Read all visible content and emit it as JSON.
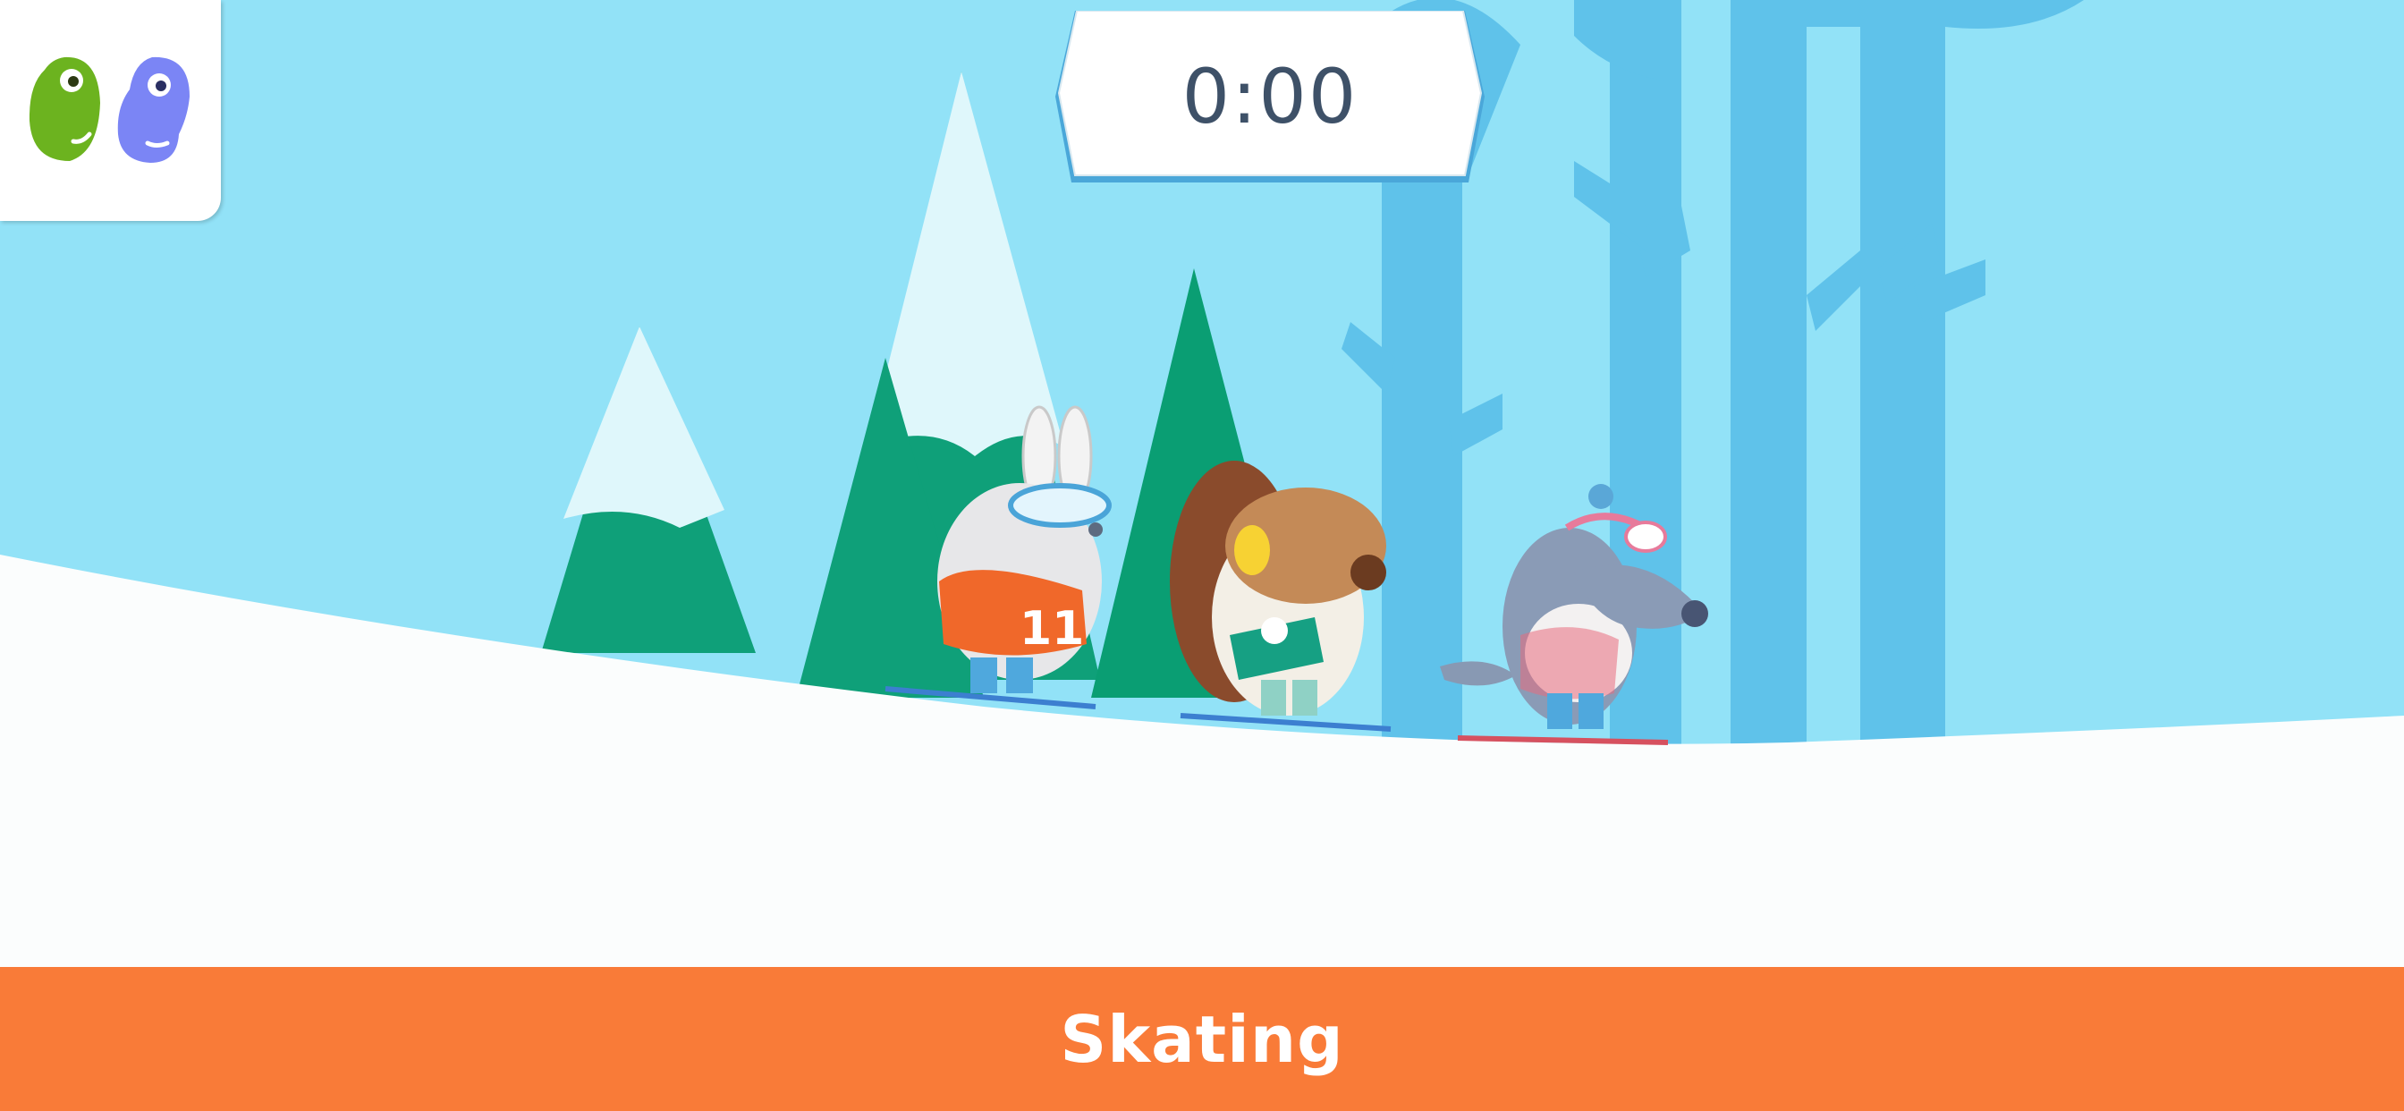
{
  "game": {
    "timer": "0:00",
    "activity_title": "Skating"
  },
  "logo": {
    "icon": "two-bean-characters-logo",
    "colors": [
      "#6cb31f",
      "#7b85f5"
    ]
  },
  "characters": [
    {
      "name": "rabbit-skier",
      "jersey_number": "11"
    },
    {
      "name": "beaver-skier"
    },
    {
      "name": "wolf-skier"
    }
  ],
  "colors": {
    "sky": "#8fdff5",
    "forest_trunks": "#5ec2ea",
    "pine_dark": "#0fa079",
    "snow": "#fbfdfd",
    "title_bar": "#f97b38",
    "timer_text": "#3e5168"
  }
}
